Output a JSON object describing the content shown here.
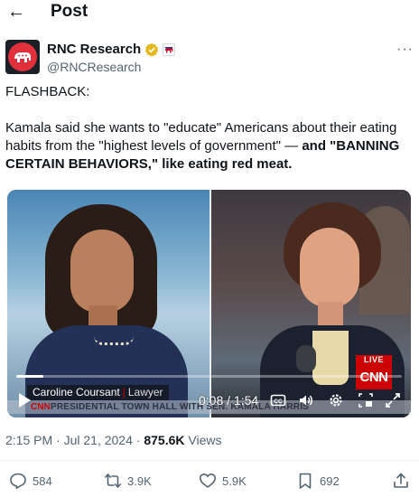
{
  "header": {
    "title": "Post",
    "back_icon": "arrow-left-icon"
  },
  "author": {
    "name": "RNC Research",
    "handle": "@RNCResearch",
    "verified_badge": "gold-verified-icon",
    "affiliation_badge": "elephant-affiliate-icon",
    "more_label": "···"
  },
  "tweet": {
    "line1": "FLASHBACK:",
    "body_plain": "Kamala said she wants to \"educate\" Americans about their eating habits from the \"highest levels of government\" — ",
    "body_bold": "and \"BANNING CERTAIN BEHAVIORS,\" like eating red meat."
  },
  "video": {
    "lower_third_name": "Caroline Coursant",
    "lower_third_role": "Lawyer",
    "chyron_logo": "CNN",
    "chyron_text": "PRESIDENTIAL TOWN HALL WITH SEN. KAMALA HARRIS",
    "live_label": "LIVE",
    "network_logo": "CNN",
    "timecode": "0:08 / 1:54",
    "progress": 0.07,
    "controls": [
      "play-icon",
      "captions-icon",
      "volume-icon",
      "settings-icon",
      "pip-icon",
      "fullscreen-icon"
    ]
  },
  "meta": {
    "time": "2:15 PM",
    "date": "Jul 21, 2024",
    "views_count": "875.6K",
    "views_label": "Views",
    "sep": " · "
  },
  "actions": {
    "replies": "584",
    "reposts": "3.9K",
    "likes": "5.9K",
    "bookmarks": "692"
  },
  "colors": {
    "text": "#0f1419",
    "muted": "#536471",
    "cnn_red": "#cc0000",
    "verified_gold": "#e2b719"
  }
}
